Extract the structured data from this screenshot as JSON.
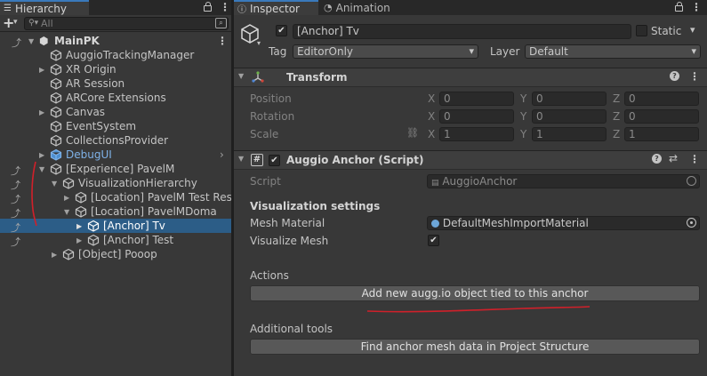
{
  "hierarchy": {
    "tab_label": "Hierarchy",
    "add_label": "+",
    "search_placeholder": "All",
    "scene_name": "MainPK",
    "items": [
      {
        "label": "AuggioTrackingManager"
      },
      {
        "label": "XR Origin"
      },
      {
        "label": "AR Session"
      },
      {
        "label": "ARCore Extensions"
      },
      {
        "label": "Canvas"
      },
      {
        "label": "EventSystem"
      },
      {
        "label": "CollectionsProvider"
      },
      {
        "label": "DebugUI"
      },
      {
        "label": "[Experience] PavelM"
      },
      {
        "label": "VisualizationHierarchy"
      },
      {
        "label": "[Location] PavelM Test Rese"
      },
      {
        "label": "[Location] PavelMDoma"
      },
      {
        "label": "[Anchor] Tv"
      },
      {
        "label": "[Anchor] Test"
      },
      {
        "label": "[Object] Pooop"
      }
    ]
  },
  "inspector": {
    "tabs": [
      {
        "label": "Inspector"
      },
      {
        "label": "Animation"
      }
    ],
    "object_name": "[Anchor] Tv",
    "static_label": "Static",
    "tag_label": "Tag",
    "tag_value": "EditorOnly",
    "layer_label": "Layer",
    "layer_value": "Default",
    "transform": {
      "title": "Transform",
      "position_label": "Position",
      "rotation_label": "Rotation",
      "scale_label": "Scale",
      "position": {
        "x": "0",
        "y": "0",
        "z": "0"
      },
      "rotation": {
        "x": "0",
        "y": "0",
        "z": "0"
      },
      "scale": {
        "x": "1",
        "y": "1",
        "z": "1"
      },
      "axis_x": "X",
      "axis_y": "Y",
      "axis_z": "Z"
    },
    "script_component": {
      "title": "Auggio Anchor (Script)",
      "script_label": "Script",
      "script_value": "AuggioAnchor",
      "section_title": "Visualization settings",
      "mesh_material_label": "Mesh Material",
      "mesh_material_value": "DefaultMeshImportMaterial",
      "visualize_mesh_label": "Visualize Mesh",
      "actions_label": "Actions",
      "add_button": "Add new augg.io object tied to this anchor",
      "tools_label": "Additional tools",
      "find_button": "Find anchor mesh data in Project Structure"
    }
  },
  "colors": {
    "selection": "#2c5d87",
    "annotation": "#d0202a",
    "prefab_blue": "#7fb2e8"
  }
}
